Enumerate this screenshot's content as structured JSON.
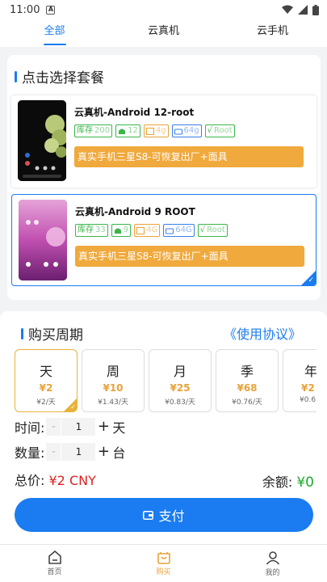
{
  "status_bar": {
    "time": "11:00",
    "notif_icon": "A"
  },
  "tabs": [
    {
      "label": "全部",
      "active": true
    },
    {
      "label": "云真机",
      "active": false
    },
    {
      "label": "云手机",
      "active": false
    }
  ],
  "packages": {
    "title": "点击选择套餐",
    "items": [
      {
        "name": "云真机-Android 12-root",
        "specs": {
          "stock": "库存",
          "stock_val": "200",
          "cpu": "12",
          "ram": "4g",
          "disk": "64g",
          "root": "Root"
        },
        "desc": "真实手机三星S8-可恢复出厂+面具",
        "selected": false
      },
      {
        "name": "云真机-Android 9 ROOT",
        "specs": {
          "stock": "库存",
          "stock_val": "33",
          "cpu": "9",
          "ram": "4G",
          "disk": "64G",
          "root": "Root"
        },
        "desc": "真实手机三星S8-可恢复出厂+面具",
        "selected": true
      }
    ]
  },
  "purchase": {
    "title": "购买周期",
    "agreement": "《使用协议》",
    "periods": [
      {
        "name": "天",
        "price": "¥2",
        "daily": "¥2/天",
        "selected": true
      },
      {
        "name": "周",
        "price": "¥10",
        "daily": "¥1.43/天",
        "selected": false
      },
      {
        "name": "月",
        "price": "¥25",
        "daily": "¥0.83/天",
        "selected": false
      },
      {
        "name": "季",
        "price": "¥68",
        "daily": "¥0.76/天",
        "selected": false
      },
      {
        "name": "年",
        "price": "¥2",
        "daily": "¥0.6",
        "selected": false
      }
    ],
    "time": {
      "label": "时间:",
      "minus": "-",
      "value": "1",
      "plus": "+",
      "unit": "天"
    },
    "quantity": {
      "label": "数量:",
      "minus": "-",
      "value": "1",
      "plus": "+",
      "unit": "台"
    },
    "total_label": "总价:",
    "total_value": "¥2 CNY",
    "balance_label": "余额:",
    "balance_value": "¥0",
    "pay_label": "支付"
  },
  "bottom_nav": [
    {
      "label": "首页",
      "icon": "home-icon",
      "active": false
    },
    {
      "label": "购买",
      "icon": "shopping-bag-icon",
      "active": true
    },
    {
      "label": "我的",
      "icon": "profile-icon",
      "active": false
    }
  ],
  "colors": {
    "accent": "#1a7cf0",
    "orange": "#f0a93c",
    "price_red": "#e02020",
    "balance_green": "#1aaa2a"
  }
}
